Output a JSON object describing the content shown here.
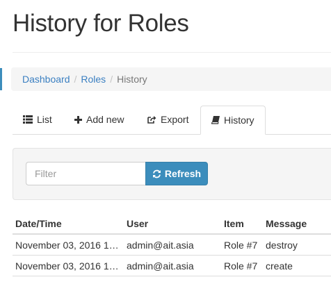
{
  "page": {
    "title": "History for Roles"
  },
  "breadcrumb": {
    "items": [
      {
        "label": "Dashboard"
      },
      {
        "label": "Roles"
      }
    ],
    "separator": "/",
    "active": "History"
  },
  "tabs": [
    {
      "label": "List",
      "icon": "list-icon"
    },
    {
      "label": "Add new",
      "icon": "plus-icon"
    },
    {
      "label": "Export",
      "icon": "export-icon"
    },
    {
      "label": "History",
      "icon": "book-icon",
      "active": true
    }
  ],
  "filter": {
    "placeholder": "Filter",
    "value": "",
    "refresh_label": "Refresh",
    "refresh_icon": "refresh-icon"
  },
  "table": {
    "columns": [
      "Date/Time",
      "User",
      "Item",
      "Message"
    ],
    "rows": [
      {
        "datetime": "November 03, 2016 1…",
        "user": "admin@ait.asia",
        "item": "Role #7",
        "message": "destroy"
      },
      {
        "datetime": "November 03, 2016 1…",
        "user": "admin@ait.asia",
        "item": "Role #7",
        "message": "create"
      }
    ]
  },
  "colors": {
    "accent": "#3c8dbc",
    "link": "#3a7fc1",
    "panel_bg": "#f5f5f5",
    "border": "#dddddd"
  }
}
